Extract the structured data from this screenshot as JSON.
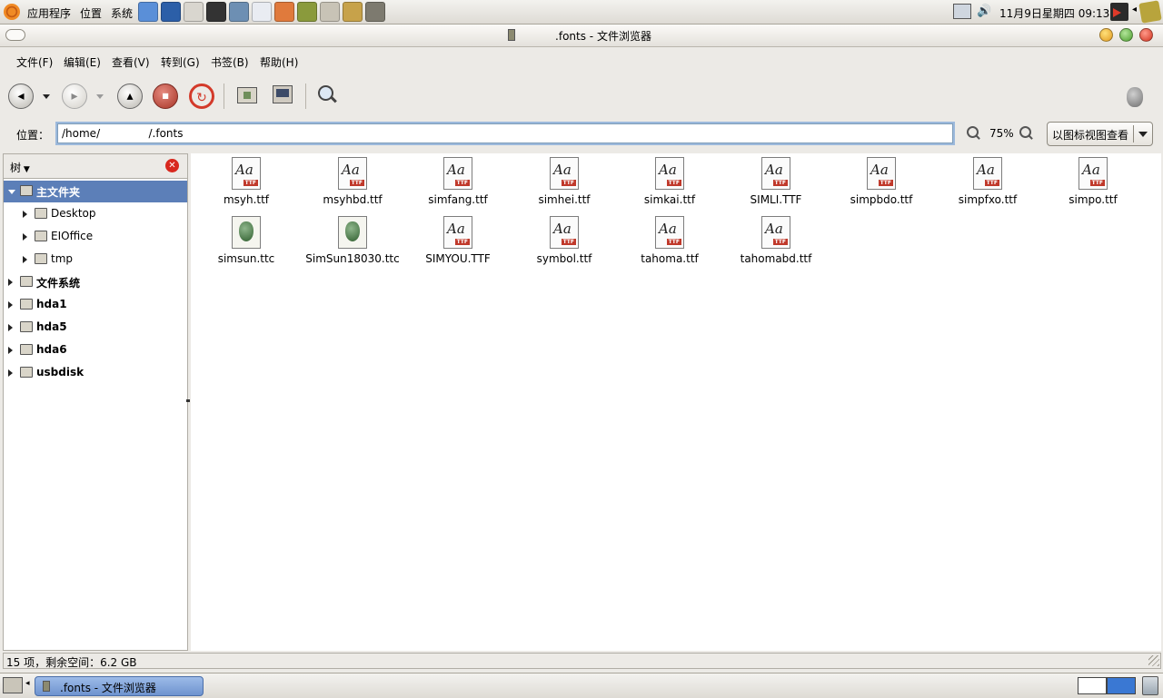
{
  "top_panel": {
    "menus": [
      "应用程序",
      "位置",
      "系统"
    ],
    "clock": "11月9日星期四 09:13",
    "launchers": [
      {
        "icon": "network-tool-icon",
        "color": "#5a8fd8"
      },
      {
        "icon": "web-browser-icon",
        "color": "#2c5fa8"
      },
      {
        "icon": "clock-icon",
        "color": "#d9d6cf"
      },
      {
        "icon": "terminal-icon",
        "color": "#333333"
      },
      {
        "icon": "messenger-icon",
        "color": "#6d8fb3"
      },
      {
        "icon": "mplayer-icon",
        "color": "#e9ecf2"
      },
      {
        "icon": "editor-icon",
        "color": "#e07a3c"
      },
      {
        "icon": "book-icon",
        "color": "#8a9a3c"
      },
      {
        "icon": "text-editor-icon",
        "color": "#c8c3b6"
      },
      {
        "icon": "pidgin-icon",
        "color": "#c7a24a"
      },
      {
        "icon": "gimp-icon",
        "color": "#7d7a6f"
      }
    ]
  },
  "window": {
    "title": ".fonts - 文件浏览器"
  },
  "menu_bar": [
    "文件(F)",
    "编辑(E)",
    "查看(V)",
    "转到(G)",
    "书签(B)",
    "帮助(H)"
  ],
  "location": {
    "label": "位置：",
    "value": "/home/              /.fonts",
    "zoom": "75%",
    "view_mode": "以图标视图查看"
  },
  "sidebar": {
    "mode": "树",
    "items": [
      {
        "label": "主文件夹",
        "level": 0,
        "expanded": true,
        "selected": true,
        "bold": true
      },
      {
        "label": "Desktop",
        "level": 1
      },
      {
        "label": "EIOffice",
        "level": 1
      },
      {
        "label": "tmp",
        "level": 1
      },
      {
        "label": "文件系统",
        "level": 0,
        "bold": true
      },
      {
        "label": "hda1",
        "level": 0,
        "bold": true
      },
      {
        "label": "hda5",
        "level": 0,
        "bold": true
      },
      {
        "label": "hda6",
        "level": 0,
        "bold": true
      },
      {
        "label": "usbdisk",
        "level": 0,
        "bold": true
      }
    ]
  },
  "files": [
    {
      "name": "msyh.ttf",
      "kind": "ttf"
    },
    {
      "name": "msyhbd.ttf",
      "kind": "ttf"
    },
    {
      "name": "simfang.ttf",
      "kind": "ttf"
    },
    {
      "name": "simhei.ttf",
      "kind": "ttf"
    },
    {
      "name": "simkai.ttf",
      "kind": "ttf"
    },
    {
      "name": "SIMLI.TTF",
      "kind": "ttf"
    },
    {
      "name": "simpbdo.ttf",
      "kind": "ttf"
    },
    {
      "name": "simpfxo.ttf",
      "kind": "ttf"
    },
    {
      "name": "simpo.ttf",
      "kind": "ttf"
    },
    {
      "name": "simsun.ttc",
      "kind": "ttc"
    },
    {
      "name": "SimSun18030.ttc",
      "kind": "ttc"
    },
    {
      "name": "SIMYOU.TTF",
      "kind": "ttf"
    },
    {
      "name": "symbol.ttf",
      "kind": "ttf"
    },
    {
      "name": "tahoma.ttf",
      "kind": "ttf"
    },
    {
      "name": "tahomabd.ttf",
      "kind": "ttf"
    }
  ],
  "font_icon": {
    "glyph": "Aa",
    "tag": "TTF"
  },
  "status": "15 项，剩余空间：6.2 GB",
  "taskbar": {
    "task": ".fonts - 文件浏览器"
  }
}
